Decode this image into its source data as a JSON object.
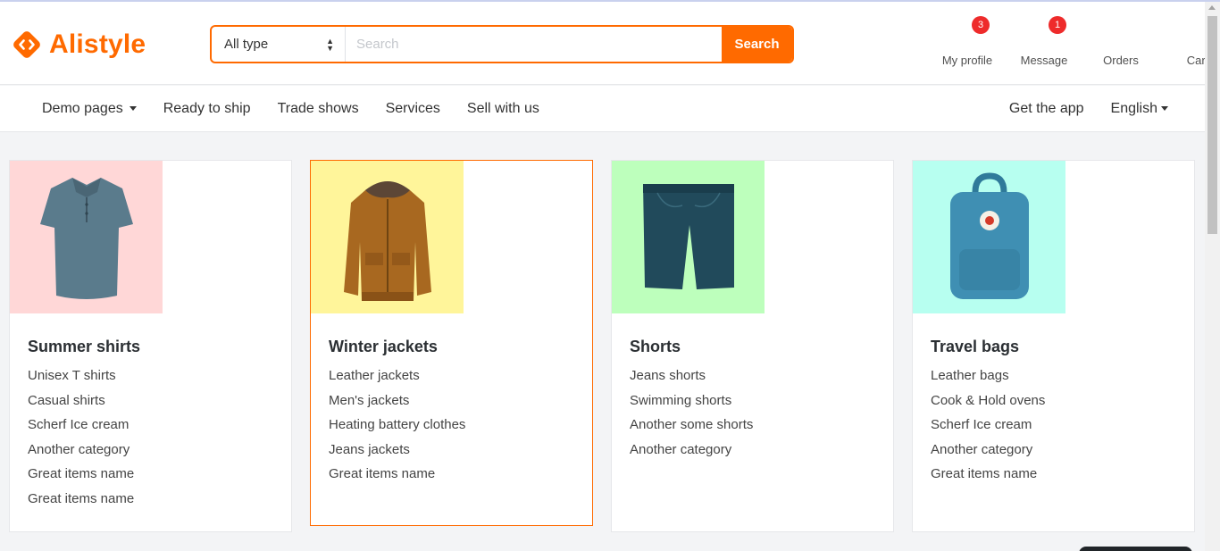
{
  "brand": {
    "name": "Alistyle",
    "accent_color": "#ff6a00"
  },
  "search": {
    "type_selected": "All type",
    "placeholder": "Search",
    "button_label": "Search"
  },
  "header_widgets": [
    {
      "label": "My profile",
      "icon": "user-icon",
      "badge": "3"
    },
    {
      "label": "Message",
      "icon": "comment-icon",
      "badge": "1"
    },
    {
      "label": "Orders",
      "icon": "heart-icon",
      "badge": ""
    },
    {
      "label": "Cart",
      "icon": "cart-icon",
      "badge": ""
    }
  ],
  "nav": {
    "left": [
      "Demo pages",
      "Ready to ship",
      "Trade shows",
      "Services",
      "Sell with us"
    ],
    "right": [
      "Get the app",
      "English"
    ]
  },
  "categories": [
    {
      "title": "Summer shirts",
      "bg_color": "#ffd7d7",
      "image": "polo-shirt-image",
      "items": [
        "Unisex T shirts",
        "Casual shirts",
        "Scherf Ice cream",
        "Another category",
        "Great items name",
        "Great items name"
      ]
    },
    {
      "title": "Winter jackets",
      "bg_color": "#fff59a",
      "image": "winter-jacket-image",
      "items": [
        "Leather jackets",
        "Men's jackets",
        "Heating battery clothes",
        "Jeans jackets",
        "Great items name"
      ]
    },
    {
      "title": "Shorts",
      "bg_color": "#bdffbc",
      "image": "denim-shorts-image",
      "items": [
        "Jeans shorts",
        "Swimming shorts",
        "Another some shorts",
        "Another category"
      ]
    },
    {
      "title": "Travel bags",
      "bg_color": "#b7fff0",
      "image": "backpack-image",
      "items": [
        "Leather bags",
        "Cook & Hold ovens",
        "Scherf Ice cream",
        "Another category",
        "Great items name"
      ]
    }
  ]
}
